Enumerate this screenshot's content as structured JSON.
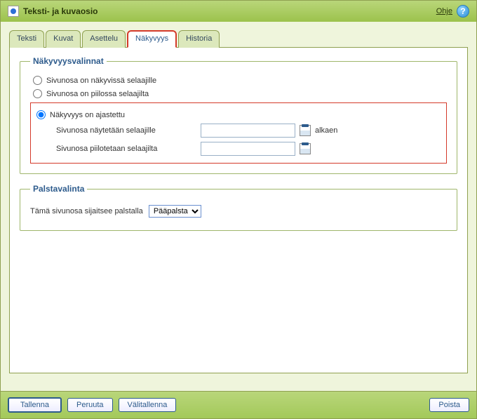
{
  "window": {
    "title": "Teksti- ja kuvaosio",
    "help_label": "Ohje",
    "help_glyph": "?"
  },
  "tabs": [
    {
      "label": "Teksti"
    },
    {
      "label": "Kuvat"
    },
    {
      "label": "Asettelu"
    },
    {
      "label": "Näkyvyys"
    },
    {
      "label": "Historia"
    }
  ],
  "visibility": {
    "legend": "Näkyvyysvalinnat",
    "options": [
      {
        "label": "Sivunosa on näkyvissä selaajille"
      },
      {
        "label": "Sivunosa on piilossa selaajilta"
      },
      {
        "label": "Näkyvyys on ajastettu"
      }
    ],
    "scheduled": {
      "show_label": "Sivunosa näytetään selaajille",
      "show_suffix": "alkaen",
      "hide_label": "Sivunosa piilotetaan selaajilta",
      "show_value": "",
      "hide_value": ""
    }
  },
  "column": {
    "legend": "Palstavalinta",
    "label": "Tämä sivunosa sijaitsee palstalla",
    "selected": "Pääpalsta"
  },
  "footer": {
    "save": "Tallenna",
    "cancel": "Peruuta",
    "interim": "Välitallenna",
    "delete": "Poista"
  }
}
